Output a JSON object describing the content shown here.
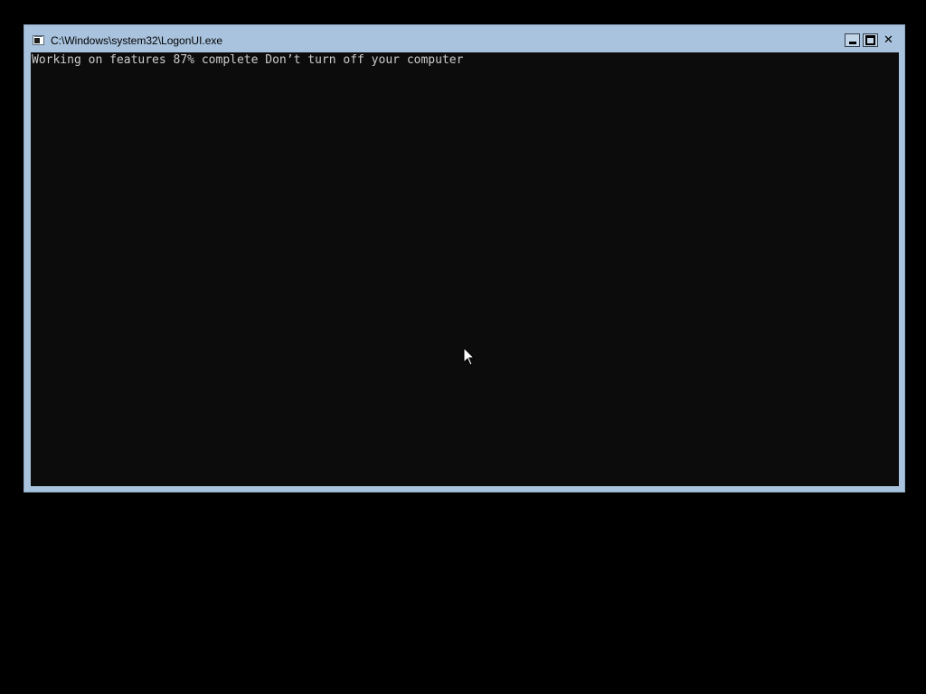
{
  "window": {
    "title": "C:\\Windows\\system32\\LogonUI.exe",
    "controls": {
      "minimize": "minimize",
      "maximize": "maximize",
      "close": "✕"
    }
  },
  "console": {
    "lines": [
      "Working on features 87% complete Don’t turn off your computer"
    ],
    "progress_percent": 87
  },
  "icons": {
    "app": "console-app-icon",
    "cursor": "mouse-pointer-icon"
  },
  "colors": {
    "desktop_bg": "#000000",
    "window_frame": "#a9c3de",
    "console_bg": "#0c0c0c",
    "console_text": "#cccccc"
  }
}
